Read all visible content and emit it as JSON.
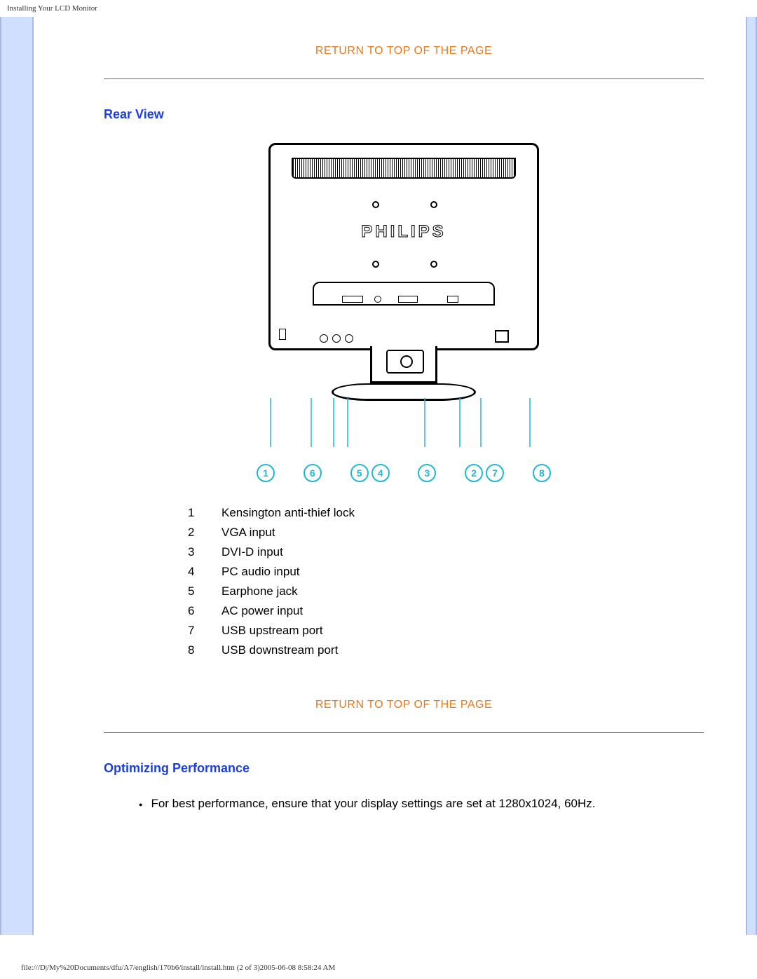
{
  "header": {
    "title": "Installing Your LCD Monitor"
  },
  "link": {
    "return_top": "RETURN TO TOP OF THE PAGE"
  },
  "rear_view": {
    "heading": "Rear View",
    "brand": "PHILIPS",
    "callout_numbers": [
      "1",
      "6",
      "5",
      "4",
      "3",
      "2",
      "7",
      "8"
    ],
    "parts": [
      {
        "n": "1",
        "label": "Kensington anti-thief lock"
      },
      {
        "n": "2",
        "label": "VGA input"
      },
      {
        "n": "3",
        "label": "DVI-D input"
      },
      {
        "n": "4",
        "label": "PC audio input"
      },
      {
        "n": "5",
        "label": "Earphone jack"
      },
      {
        "n": "6",
        "label": "AC power input"
      },
      {
        "n": "7",
        "label": "USB upstream port"
      },
      {
        "n": "8",
        "label": "USB downstream port"
      }
    ]
  },
  "optimize": {
    "heading": "Optimizing Performance",
    "bullets": [
      "For best performance, ensure that your display settings are set at 1280x1024, 60Hz."
    ]
  },
  "footer": {
    "path": "file:///D|/My%20Documents/dfu/A7/english/170b6/install/install.htm (2 of 3)2005-06-08 8:58:24 AM"
  }
}
